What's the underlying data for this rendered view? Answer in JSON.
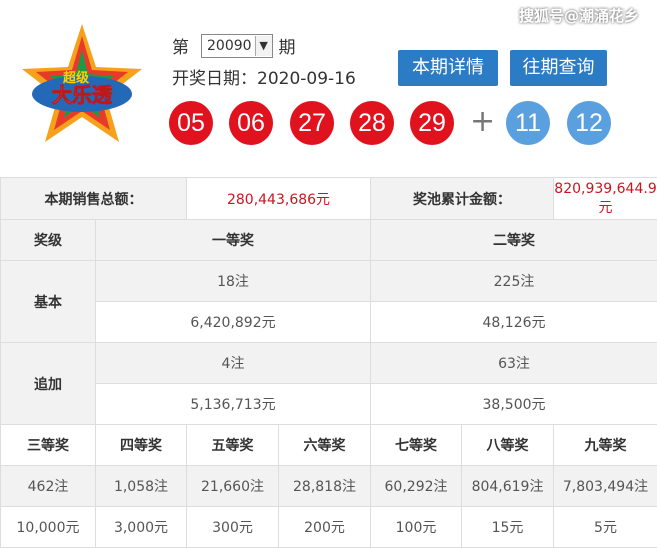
{
  "header": {
    "watermark": "搜狐号@潮涌花乡",
    "issue_prefix": "第",
    "issue_value": "20090",
    "issue_suffix": "期",
    "draw_date_label": "开奖日期：2020-09-16",
    "btn_current": "本期详情",
    "btn_history": "往期查询",
    "logo_text_top": "超级",
    "logo_text_main": "大乐透",
    "red_balls": [
      "05",
      "06",
      "27",
      "28",
      "29"
    ],
    "plus": "+",
    "blue_balls": [
      "11",
      "12"
    ]
  },
  "summary": {
    "sales_label": "本期销售总额：",
    "sales_value": "280,443,686元",
    "pool_label": "奖池累计金额：",
    "pool_value": "820,939,644.9元"
  },
  "table1": {
    "h_level": "奖级",
    "h_first": "一等奖",
    "h_second": "二等奖",
    "basic_label": "基本",
    "basic_first_count": "18注",
    "basic_second_count": "225注",
    "basic_first_amount": "6,420,892元",
    "basic_second_amount": "48,126元",
    "extra_label": "追加",
    "extra_first_count": "4注",
    "extra_second_count": "63注",
    "extra_first_amount": "5,136,713元",
    "extra_second_amount": "38,500元"
  },
  "table2": {
    "headers": [
      "三等奖",
      "四等奖",
      "五等奖",
      "六等奖",
      "七等奖",
      "八等奖",
      "九等奖"
    ],
    "counts": [
      "462注",
      "1,058注",
      "21,660注",
      "28,818注",
      "60,292注",
      "804,619注",
      "7,803,494注"
    ],
    "amounts": [
      "10,000元",
      "3,000元",
      "300元",
      "200元",
      "100元",
      "15元",
      "5元"
    ]
  },
  "colors": {
    "red_ball": "#e0121e",
    "blue_ball": "#5a9fde",
    "button": "#2b7cc4",
    "value_red": "#c8161e"
  }
}
